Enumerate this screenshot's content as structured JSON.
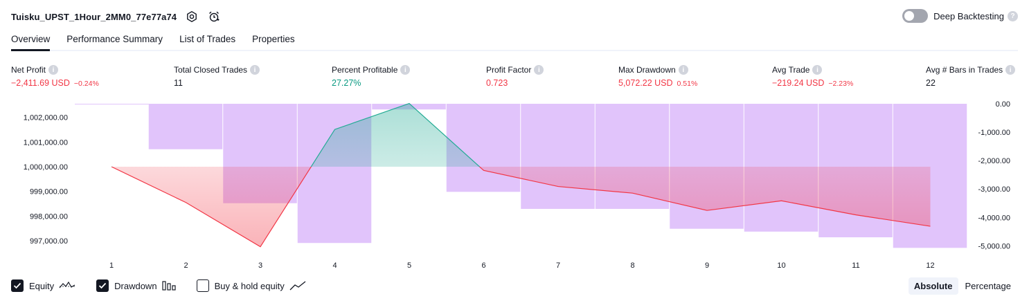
{
  "header": {
    "title": "Tuisku_UPST_1Hour_2MM0_77e77a74",
    "settings_icon": "gear-icon",
    "alert_icon": "alarm-clock-icon"
  },
  "deep_backtesting": {
    "label": "Deep Backtesting",
    "enabled": false
  },
  "tabs": [
    {
      "label": "Overview",
      "active": true
    },
    {
      "label": "Performance Summary",
      "active": false
    },
    {
      "label": "List of Trades",
      "active": false
    },
    {
      "label": "Properties",
      "active": false
    }
  ],
  "metrics": {
    "net_profit": {
      "label": "Net Profit",
      "value": "−2,411.69 USD",
      "sub": "−0.24%"
    },
    "total_closed_trades": {
      "label": "Total Closed Trades",
      "value": "11"
    },
    "percent_profitable": {
      "label": "Percent Profitable",
      "value": "27.27%"
    },
    "profit_factor": {
      "label": "Profit Factor",
      "value": "0.723"
    },
    "max_drawdown": {
      "label": "Max Drawdown",
      "value": "5,072.22 USD",
      "sub": "0.51%"
    },
    "avg_trade": {
      "label": "Avg Trade",
      "value": "−219.24 USD",
      "sub": "−2.23%"
    },
    "avg_bars": {
      "label": "Avg # Bars in Trades",
      "value": "22"
    }
  },
  "chart_data": {
    "type": "line",
    "x": [
      1,
      2,
      3,
      4,
      5,
      6,
      7,
      8,
      9,
      10,
      11,
      12
    ],
    "left_axis": {
      "ticks": [
        "1,002,000.00",
        "1,001,000.00",
        "1,000,000.00",
        "999,000.00",
        "998,000.00",
        "997,000.00"
      ],
      "tick_values": [
        1002000,
        1001000,
        1000000,
        999000,
        998000,
        997000
      ]
    },
    "right_axis": {
      "ticks": [
        "0.00",
        "-1,000.00",
        "-2,000.00",
        "-3,000.00",
        "-4,000.00",
        "-5,000.00"
      ],
      "tick_values": [
        0,
        -1000,
        -2000,
        -3000,
        -4000,
        -5000
      ]
    },
    "series": [
      {
        "name": "Equity",
        "values": [
          1000000,
          998550,
          996760,
          1001510,
          1002560,
          999850,
          999200,
          998930,
          998230,
          998620,
          998050,
          997590
        ]
      },
      {
        "name": "Drawdown",
        "type": "bar",
        "values": [
          0,
          -1600,
          -3500,
          -4900,
          -200,
          -3100,
          -3700,
          -3700,
          -4400,
          -4500,
          -4700,
          -5072
        ]
      }
    ],
    "colors": {
      "equity_up": "#22ab94",
      "equity_down": "#f23645",
      "drawdown_bar": "#e1c4fb"
    }
  },
  "legend": [
    {
      "label": "Equity",
      "checked": true,
      "icon": "equity-line-icon"
    },
    {
      "label": "Drawdown",
      "checked": true,
      "icon": "drawdown-bars-icon"
    },
    {
      "label": "Buy & hold equity",
      "checked": false,
      "icon": "buy-hold-line-icon"
    }
  ],
  "view_mode": {
    "options": [
      "Absolute",
      "Percentage"
    ],
    "selected": "Absolute"
  }
}
